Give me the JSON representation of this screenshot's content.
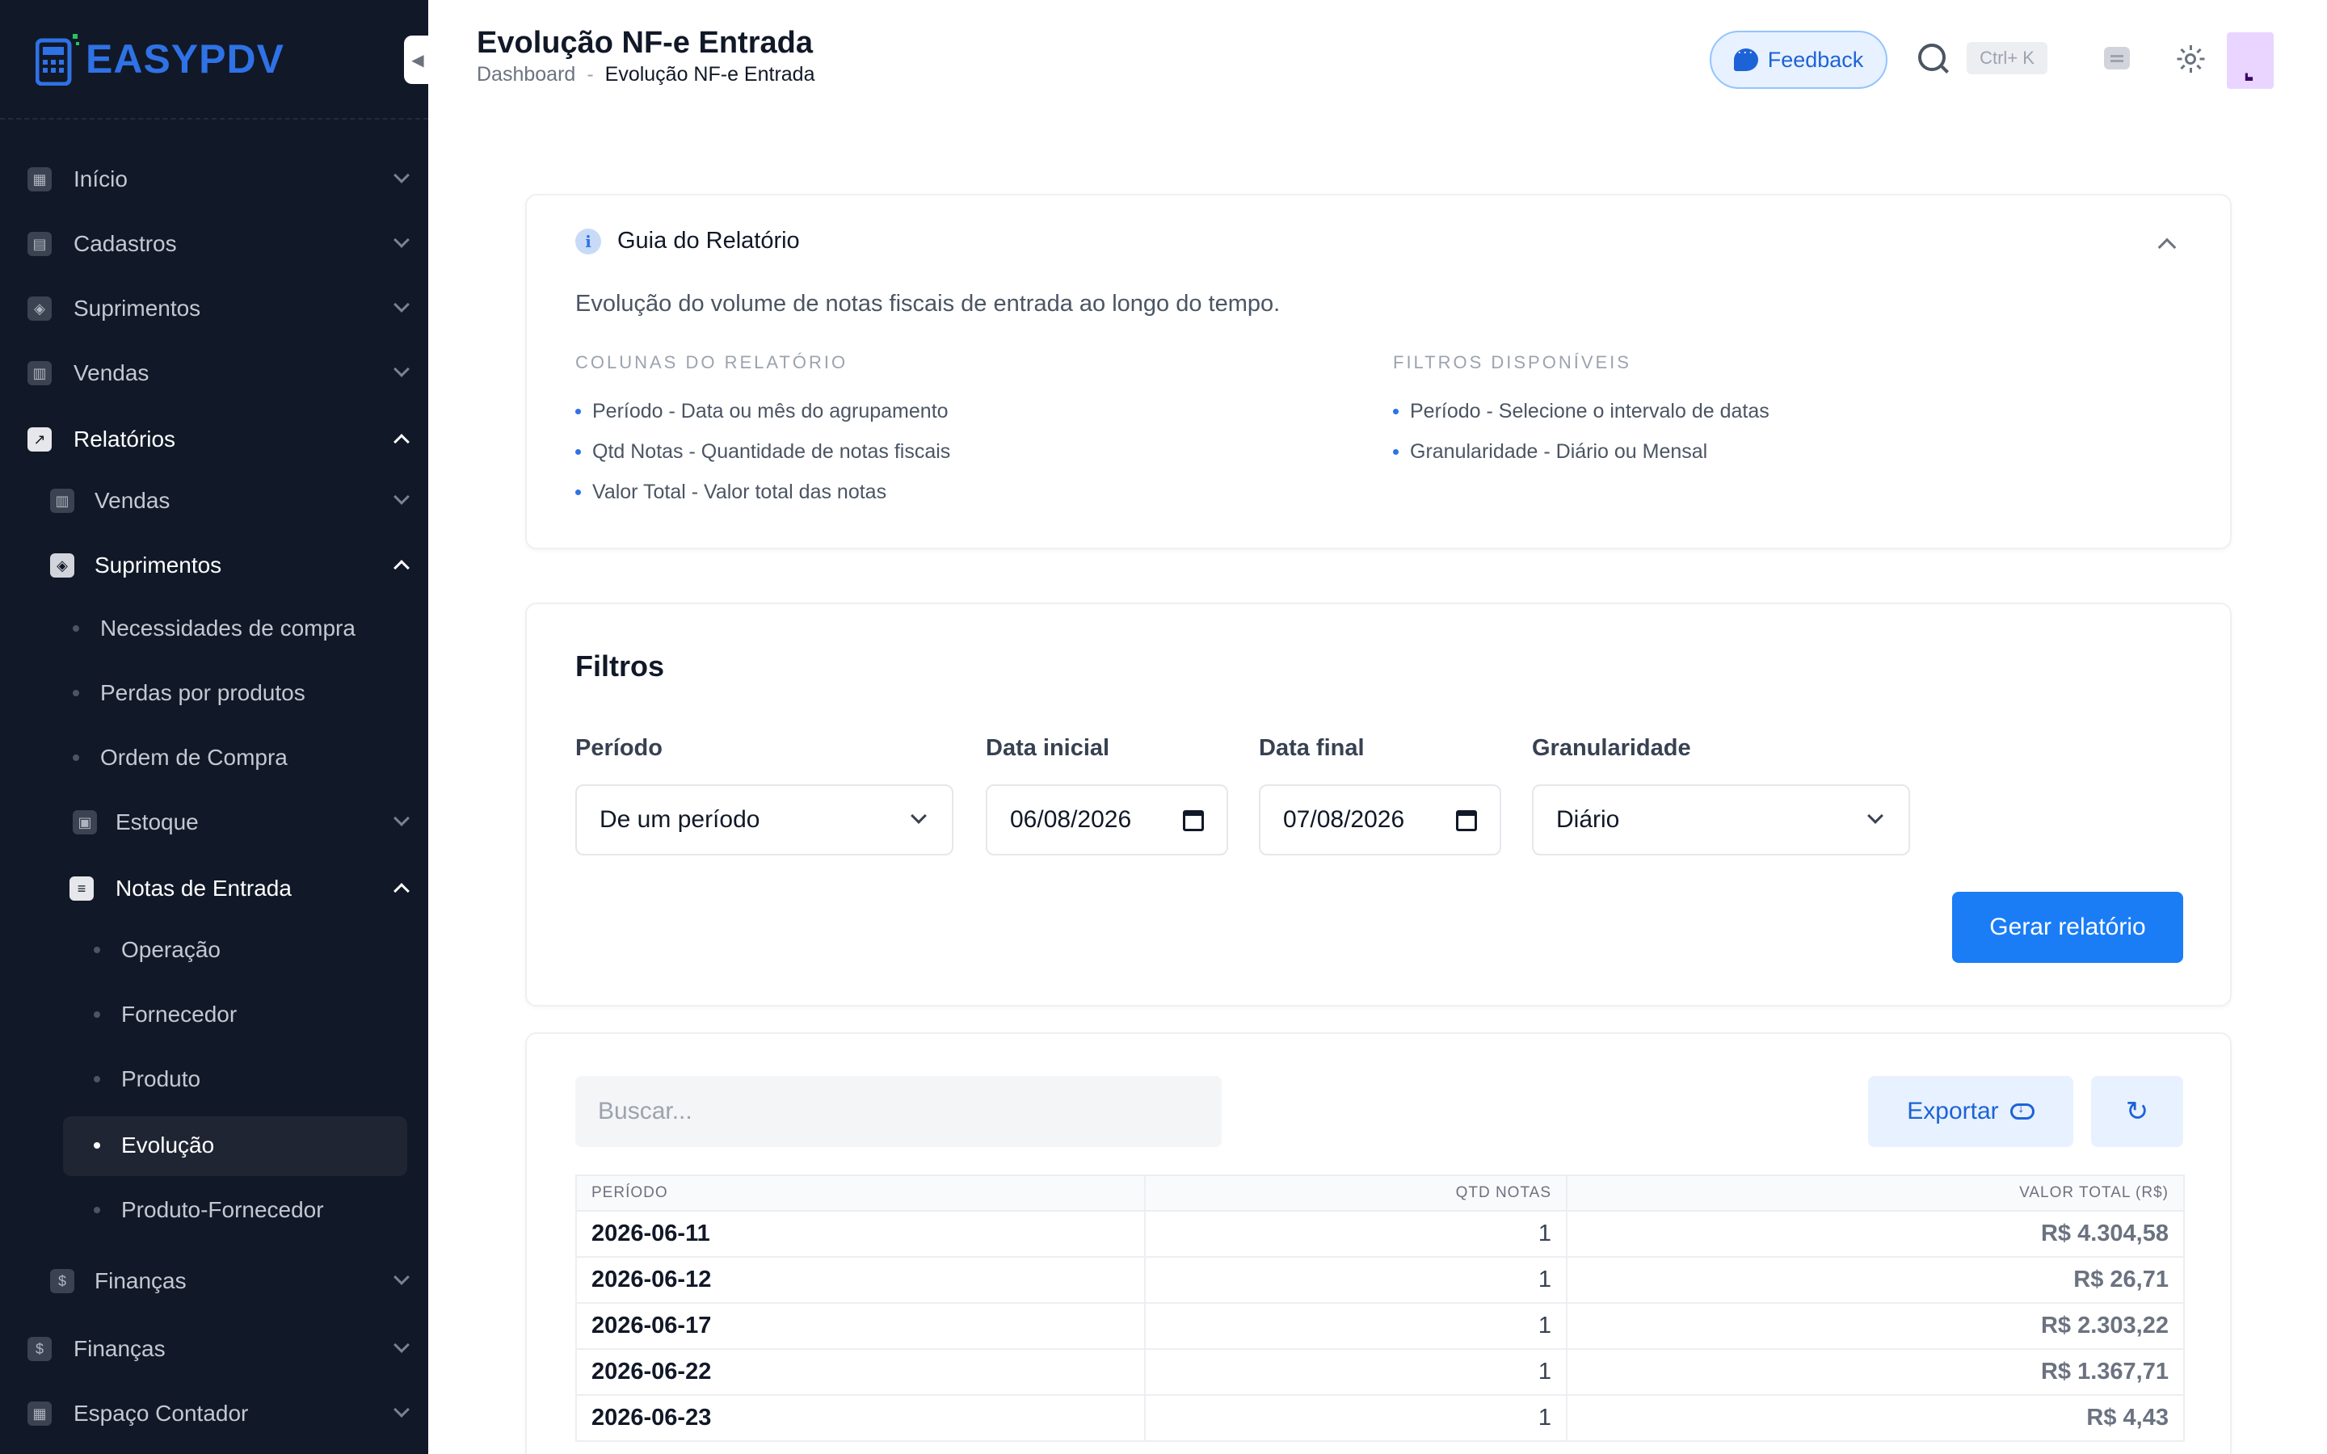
{
  "brand": {
    "logo_prefix": "EASY",
    "logo_suffix": "PDV"
  },
  "sidebar": {
    "items": [
      {
        "label": "Início",
        "icon": "dashboard-icon"
      },
      {
        "label": "Cadastros",
        "icon": "id-card-icon"
      },
      {
        "label": "Suprimentos",
        "icon": "box-icon"
      },
      {
        "label": "Vendas",
        "icon": "register-icon"
      },
      {
        "label": "Relatórios",
        "icon": "chart-icon",
        "expanded": true
      },
      {
        "label": "Vendas",
        "icon": "register-icon"
      },
      {
        "label": "Suprimentos",
        "icon": "box-icon",
        "expanded": true
      },
      {
        "label": "Necessidades de compra"
      },
      {
        "label": "Perdas por produtos"
      },
      {
        "label": "Ordem de Compra"
      },
      {
        "label": "Estoque",
        "icon": "lock-icon"
      },
      {
        "label": "Notas de Entrada",
        "icon": "invoice-icon",
        "expanded": true
      },
      {
        "label": "Operação"
      },
      {
        "label": "Fornecedor"
      },
      {
        "label": "Produto"
      },
      {
        "label": "Evolução",
        "active": true
      },
      {
        "label": "Produto-Fornecedor"
      },
      {
        "label": "Finanças",
        "icon": "dollar-icon"
      },
      {
        "label": "Finanças",
        "icon": "dollar-icon"
      },
      {
        "label": "Espaço Contador",
        "icon": "calculator-icon"
      }
    ]
  },
  "header": {
    "title": "Evolução NF-e Entrada",
    "breadcrumb": {
      "home": "Dashboard",
      "separator": "-",
      "current": "Evolução NF-e Entrada"
    },
    "feedback_label": "Feedback",
    "shortcut": "Ctrl+ K"
  },
  "guide": {
    "title": "Guia do Relatório",
    "description": "Evolução do volume de notas fiscais de entrada ao longo do tempo.",
    "columns_title": "COLUNAS DO RELATÓRIO",
    "columns": [
      "Período - Data ou mês do agrupamento",
      "Qtd Notas - Quantidade de notas fiscais",
      "Valor Total - Valor total das notas"
    ],
    "filters_title": "FILTROS DISPONÍVEIS",
    "filters": [
      "Período - Selecione o intervalo de datas",
      "Granularidade - Diário ou Mensal"
    ]
  },
  "filters": {
    "title": "Filtros",
    "period_label": "Período",
    "period_value": "De um período",
    "start_label": "Data inicial",
    "start_value": "06/08/2026",
    "end_label": "Data final",
    "end_value": "07/08/2026",
    "granularity_label": "Granularidade",
    "granularity_value": "Diário",
    "generate_label": "Gerar relatório"
  },
  "table": {
    "search_placeholder": "Buscar...",
    "export_label": "Exportar",
    "headers": [
      "PERÍODO",
      "QTD NOTAS",
      "VALOR TOTAL (R$)"
    ],
    "rows": [
      {
        "periodo": "2026-06-11",
        "qtd": "1",
        "valor": "R$ 4.304,58"
      },
      {
        "periodo": "2026-06-12",
        "qtd": "1",
        "valor": "R$ 26,71"
      },
      {
        "periodo": "2026-06-17",
        "qtd": "1",
        "valor": "R$ 2.303,22"
      },
      {
        "periodo": "2026-06-22",
        "qtd": "1",
        "valor": "R$ 1.367,71"
      },
      {
        "periodo": "2026-06-23",
        "qtd": "1",
        "valor": "R$ 4,43"
      }
    ]
  },
  "colors": {
    "accent": "#1a7df6",
    "sidebar_bg": "#111827"
  }
}
